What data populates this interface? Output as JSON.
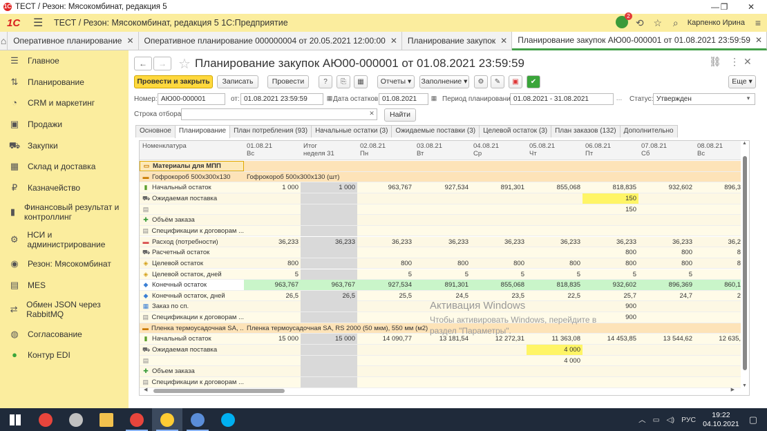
{
  "window": {
    "title": "ТЕСТ / Резон: Мясокомбинат, редакция 5",
    "controls": [
      "—",
      "❐",
      "✕"
    ]
  },
  "appbar": {
    "logo": "1С",
    "title": "ТЕСТ / Резон: Мясокомбинат, редакция 5 1С:Предприятие",
    "notifications": "2",
    "user": "Карпенко Ирина"
  },
  "tabs": [
    {
      "label": "Оперативное планирование"
    },
    {
      "label": "Оперативное планирование 000000004 от 20.05.2021 12:00:00"
    },
    {
      "label": "Планирование закупок"
    },
    {
      "label": "Планирование закупок АЮ00-000001 от 01.08.2021 23:59:59"
    }
  ],
  "sidebar": {
    "items": [
      {
        "label": "Главное",
        "icon": "☰"
      },
      {
        "label": "Планирование",
        "icon": "⇅"
      },
      {
        "label": "CRM и маркетинг",
        "icon": "◔"
      },
      {
        "label": "Продажи",
        "icon": "▣"
      },
      {
        "label": "Закупки",
        "icon": "⛟"
      },
      {
        "label": "Склад и доставка",
        "icon": "▦"
      },
      {
        "label": "Казначейство",
        "icon": "₽"
      },
      {
        "label": "Финансовый результат и контроллинг",
        "icon": "▮"
      },
      {
        "label": "НСИ и администрирование",
        "icon": "⚙"
      },
      {
        "label": "Резон: Мясокомбинат",
        "icon": "◉"
      },
      {
        "label": "MES",
        "icon": "▤"
      },
      {
        "label": "Обмен JSON через RabbitMQ",
        "icon": "⇄"
      },
      {
        "label": "Согласование",
        "icon": "◍"
      },
      {
        "label": "Контур EDI",
        "icon": "●"
      }
    ]
  },
  "form": {
    "title": "Планирование закупок АЮ00-000001 от 01.08.2021 23:59:59",
    "toolbar": {
      "post_close": "Провести и закрыть",
      "write": "Записать",
      "post": "Провести",
      "help": "?",
      "reports": "Отчеты",
      "fill": "Заполнение",
      "more": "Еще"
    },
    "fields": {
      "number_label": "Номер:",
      "number": "АЮ00-000001",
      "from_label": "от:",
      "date": "01.08.2021 23:59:59",
      "stock_label": "Дата остатков:",
      "stock_date": "01.08.2021",
      "period_label": "Период планирования:",
      "period": "01.08.2021 - 31.08.2021",
      "status_label": "Статус:",
      "status": "Утвержден",
      "filter_label": "Строка отбора:",
      "filter_value": "",
      "find": "Найти"
    },
    "form_tabs": [
      "Основное",
      "Планирование",
      "План потребления (93)",
      "Начальные остатки (3)",
      "Ожидаемые поставки (3)",
      "Целевой остаток (3)",
      "План заказов (132)",
      "Дополнительно"
    ]
  },
  "grid": {
    "columns": [
      {
        "l1": "Номенклатура",
        "l2": ""
      },
      {
        "l1": "01.08.21",
        "l2": "Вс"
      },
      {
        "l1": "Итог",
        "l2": "неделя 31"
      },
      {
        "l1": "02.08.21",
        "l2": "Пн"
      },
      {
        "l1": "03.08.21",
        "l2": "Вт"
      },
      {
        "l1": "04.08.21",
        "l2": "Ср"
      },
      {
        "l1": "05.08.21",
        "l2": "Чт"
      },
      {
        "l1": "06.08.21",
        "l2": "Пт"
      },
      {
        "l1": "07.08.21",
        "l2": "Сб"
      },
      {
        "l1": "08.08.21",
        "l2": "Вс"
      }
    ],
    "rows": [
      {
        "name": "Материалы для МПП",
        "kind": "group",
        "icon": "▭",
        "cells": [
          "",
          "",
          "",
          "",
          "",
          "",
          "",
          "",
          ""
        ]
      },
      {
        "name": "Гофрокороб 500х300х130",
        "kind": "item",
        "icon": "▬",
        "span": "Гофрокороб 500х300х130 (шт)",
        "cells": [
          "",
          "",
          "",
          "",
          "",
          "",
          "",
          "",
          ""
        ]
      },
      {
        "name": "Начальный остаток",
        "icon": "▮",
        "iconColor": "#5a9e2a",
        "cells": [
          "1 000",
          "1 000",
          "963,767",
          "927,534",
          "891,301",
          "855,068",
          "818,835",
          "932,602",
          "896,3"
        ]
      },
      {
        "name": "Ожидаемая поставка",
        "icon": "⛟",
        "iconColor": "#666",
        "cells": [
          "",
          "",
          "",
          "",
          "",
          "",
          "150",
          "",
          ""
        ],
        "highlight": {
          "6": "yellow"
        }
      },
      {
        "name": "",
        "icon": "▤",
        "iconColor": "#888",
        "cells": [
          "",
          "",
          "",
          "",
          "",
          "",
          "150",
          "",
          ""
        ]
      },
      {
        "name": "Объём заказа",
        "icon": "✚",
        "iconColor": "#3a9b3a",
        "cells": [
          "",
          "",
          "",
          "",
          "",
          "",
          "",
          "",
          ""
        ]
      },
      {
        "name": "Спецификации к договорам ...",
        "icon": "▤",
        "iconColor": "#888",
        "cells": [
          "",
          "",
          "",
          "",
          "",
          "",
          "",
          "",
          ""
        ]
      },
      {
        "name": "Расход (потребности)",
        "icon": "▬",
        "iconColor": "#d84a4a",
        "cells": [
          "36,233",
          "36,233",
          "36,233",
          "36,233",
          "36,233",
          "36,233",
          "36,233",
          "36,233",
          "36,2"
        ]
      },
      {
        "name": "Расчетный остаток",
        "icon": "⛟",
        "iconColor": "#666",
        "cells": [
          "",
          "",
          "",
          "",
          "",
          "",
          "800",
          "800",
          "8"
        ]
      },
      {
        "name": "Целевой остаток",
        "icon": "◈",
        "iconColor": "#d4a017",
        "cells": [
          "800",
          "",
          "800",
          "800",
          "800",
          "800",
          "800",
          "800",
          "8"
        ]
      },
      {
        "name": "Целевой остаток, дней",
        "icon": "◈",
        "iconColor": "#d4a017",
        "cells": [
          "5",
          "",
          "5",
          "5",
          "5",
          "5",
          "5",
          "5",
          ""
        ]
      },
      {
        "name": "Конечный остаток",
        "icon": "◆",
        "iconColor": "#3a7fd4",
        "cells": [
          "963,767",
          "963,767",
          "927,534",
          "891,301",
          "855,068",
          "818,835",
          "932,602",
          "896,369",
          "860,1"
        ],
        "rowColor": "#c9f5c9"
      },
      {
        "name": "Конечный остаток, дней",
        "icon": "◆",
        "iconColor": "#3a7fd4",
        "cells": [
          "26,5",
          "26,5",
          "25,5",
          "24,5",
          "23,5",
          "22,5",
          "25,7",
          "24,7",
          "2"
        ]
      },
      {
        "name": "Заказ по сп.",
        "icon": "▦",
        "iconColor": "#3a7fd4",
        "cells": [
          "",
          "",
          "",
          "",
          "",
          "",
          "900",
          "",
          ""
        ]
      },
      {
        "name": "Спецификации к договорам ...",
        "icon": "▤",
        "iconColor": "#888",
        "cells": [
          "",
          "",
          "",
          "",
          "",
          "",
          "900",
          "",
          ""
        ]
      },
      {
        "name": "Пленка термоусадочная SA, ...",
        "kind": "item",
        "icon": "▬",
        "span": "Пленка термоусадочная SA, RS 2000 (50 мкм), 550 мм (м2)",
        "cells": [
          "",
          "",
          "",
          "",
          "",
          "",
          "",
          "",
          ""
        ]
      },
      {
        "name": "Начальный остаток",
        "icon": "▮",
        "iconColor": "#5a9e2a",
        "cells": [
          "15 000",
          "15 000",
          "14 090,77",
          "13 181,54",
          "12 272,31",
          "11 363,08",
          "14 453,85",
          "13 544,62",
          "12 635,"
        ]
      },
      {
        "name": "Ожидаемая поставка",
        "icon": "⛟",
        "iconColor": "#666",
        "cells": [
          "",
          "",
          "",
          "",
          "",
          "4 000",
          "",
          "",
          ""
        ],
        "highlight": {
          "5": "yellow"
        }
      },
      {
        "name": "",
        "icon": "▤",
        "iconColor": "#888",
        "cells": [
          "",
          "",
          "",
          "",
          "",
          "4 000",
          "",
          "",
          ""
        ]
      },
      {
        "name": "Объем заказа",
        "icon": "✚",
        "iconColor": "#3a9b3a",
        "cells": [
          "",
          "",
          "",
          "",
          "",
          "",
          "",
          "",
          ""
        ]
      },
      {
        "name": "Спецификации к договорам ...",
        "icon": "▤",
        "iconColor": "#888",
        "cells": [
          "",
          "",
          "",
          "",
          "",
          "",
          "",
          "",
          ""
        ]
      }
    ]
  },
  "watermark": {
    "line1": "Активация Windows",
    "line2": "Чтобы активировать Windows, перейдите в",
    "line3": "раздел \"Параметры\"."
  },
  "taskbar": {
    "apps": [
      {
        "name": "windows-start",
        "color": "#ffffff"
      },
      {
        "name": "chrome",
        "color": "#e8453c"
      },
      {
        "name": "app-2",
        "color": "#c0c0c0"
      },
      {
        "name": "explorer",
        "color": "#f2c14e"
      },
      {
        "name": "chrome-2",
        "color": "#e8453c"
      },
      {
        "name": "1c",
        "color": "#ffcc33"
      },
      {
        "name": "remote",
        "color": "#5a8dd8"
      },
      {
        "name": "skype",
        "color": "#00aff0"
      }
    ],
    "lang": "РУС",
    "time": "19:22",
    "date": "04.10.2021"
  },
  "colors": {
    "accent": "#fbed9e",
    "green_row": "#c9f5c9",
    "yellow_cell": "#fff566",
    "group_row": "#fde3b8",
    "item_row": "#fde3b8"
  }
}
